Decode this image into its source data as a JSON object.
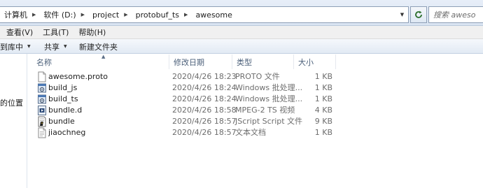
{
  "address": {
    "crumbs": [
      "计算机",
      "软件 (D:)",
      "project",
      "protobuf_ts",
      "awesome"
    ]
  },
  "search": {
    "placeholder": "搜索 awesome"
  },
  "menubar": [
    "查看(V)",
    "工具(T)",
    "帮助(H)"
  ],
  "commandbar": {
    "include_in_library": "到库中",
    "share": "共享",
    "new_folder": "新建文件夹"
  },
  "nav": {
    "partial_label": "的位置"
  },
  "columns": {
    "name": "名称",
    "date": "修改日期",
    "type": "类型",
    "size": "大小"
  },
  "files": [
    {
      "name": "awesome.proto",
      "date": "2020/4/26 18:23",
      "type": "PROTO 文件",
      "size": "1 KB",
      "icon": "blank-file-icon"
    },
    {
      "name": "build_js",
      "date": "2020/4/26 18:24",
      "type": "Windows 批处理...",
      "size": "1 KB",
      "icon": "batch-file-icon"
    },
    {
      "name": "build_ts",
      "date": "2020/4/26 18:24",
      "type": "Windows 批处理...",
      "size": "1 KB",
      "icon": "batch-file-icon"
    },
    {
      "name": "bundle.d",
      "date": "2020/4/26 18:58",
      "type": "MPEG-2 TS 视频",
      "size": "4 KB",
      "icon": "video-file-icon"
    },
    {
      "name": "bundle",
      "date": "2020/4/26 18:57",
      "type": "JScript Script 文件",
      "size": "9 KB",
      "icon": "script-file-icon"
    },
    {
      "name": "jiaochneg",
      "date": "2020/4/26 18:57",
      "type": "文本文档",
      "size": "1 KB",
      "icon": "text-file-icon"
    }
  ]
}
